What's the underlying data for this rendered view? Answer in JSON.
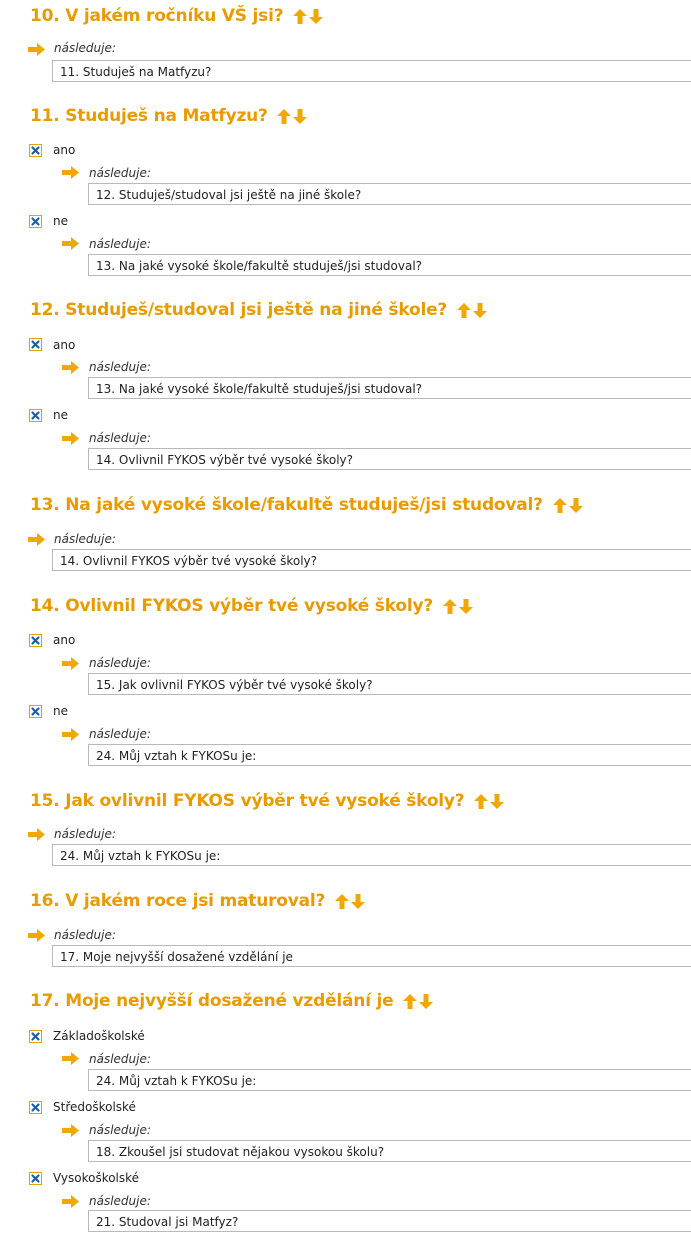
{
  "colors": {
    "accent": "#e89b00",
    "check_blue": "#1a5fa8",
    "box_border": "#b9b9b9"
  },
  "follows_label": "následuje:",
  "questions": [
    {
      "title": "10. V jakém ročníku VŠ jsi?",
      "next": "11. Studuješ na Matfyzu?",
      "options": []
    },
    {
      "title": "11. Studuješ na Matfyzu?",
      "options": [
        {
          "label": "ano",
          "next": "12. Studuješ/studoval jsi ještě na jiné škole?"
        },
        {
          "label": "ne",
          "next": "13. Na jaké vysoké škole/fakultě studuješ/jsi studoval?"
        }
      ]
    },
    {
      "title": "12. Studuješ/studoval jsi ještě na jiné škole?",
      "options": [
        {
          "label": "ano",
          "next": "13. Na jaké vysoké škole/fakultě studuješ/jsi studoval?"
        },
        {
          "label": "ne",
          "next": "14. Ovlivnil FYKOS výběr tvé vysoké školy?"
        }
      ]
    },
    {
      "title": "13. Na jaké vysoké škole/fakultě studuješ/jsi studoval?",
      "next": "14. Ovlivnil FYKOS výběr tvé vysoké školy?",
      "options": []
    },
    {
      "title": "14. Ovlivnil FYKOS výběr tvé vysoké školy?",
      "options": [
        {
          "label": "ano",
          "next": "15. Jak ovlivnil FYKOS výběr tvé vysoké školy?"
        },
        {
          "label": "ne",
          "next": "24. Můj vztah k FYKOSu je:"
        }
      ]
    },
    {
      "title": "15. Jak ovlivnil FYKOS výběr tvé vysoké školy?",
      "next": "24. Můj vztah k FYKOSu je:",
      "options": []
    },
    {
      "title": "16. V jakém roce jsi maturoval?",
      "next": "17. Moje nejvyšší dosažené vzdělání je",
      "options": []
    },
    {
      "title": "17. Moje nejvyšší dosažené vzdělání je",
      "options": [
        {
          "label": "Základoškolské",
          "next": "24. Můj vztah k FYKOSu je:"
        },
        {
          "label": "Středoškolské",
          "next": "18. Zkoušel jsi studovat nějakou vysokou školu?"
        },
        {
          "label": "Vysokoškolské",
          "next": "21. Studoval jsi Matfyz?"
        }
      ]
    }
  ]
}
